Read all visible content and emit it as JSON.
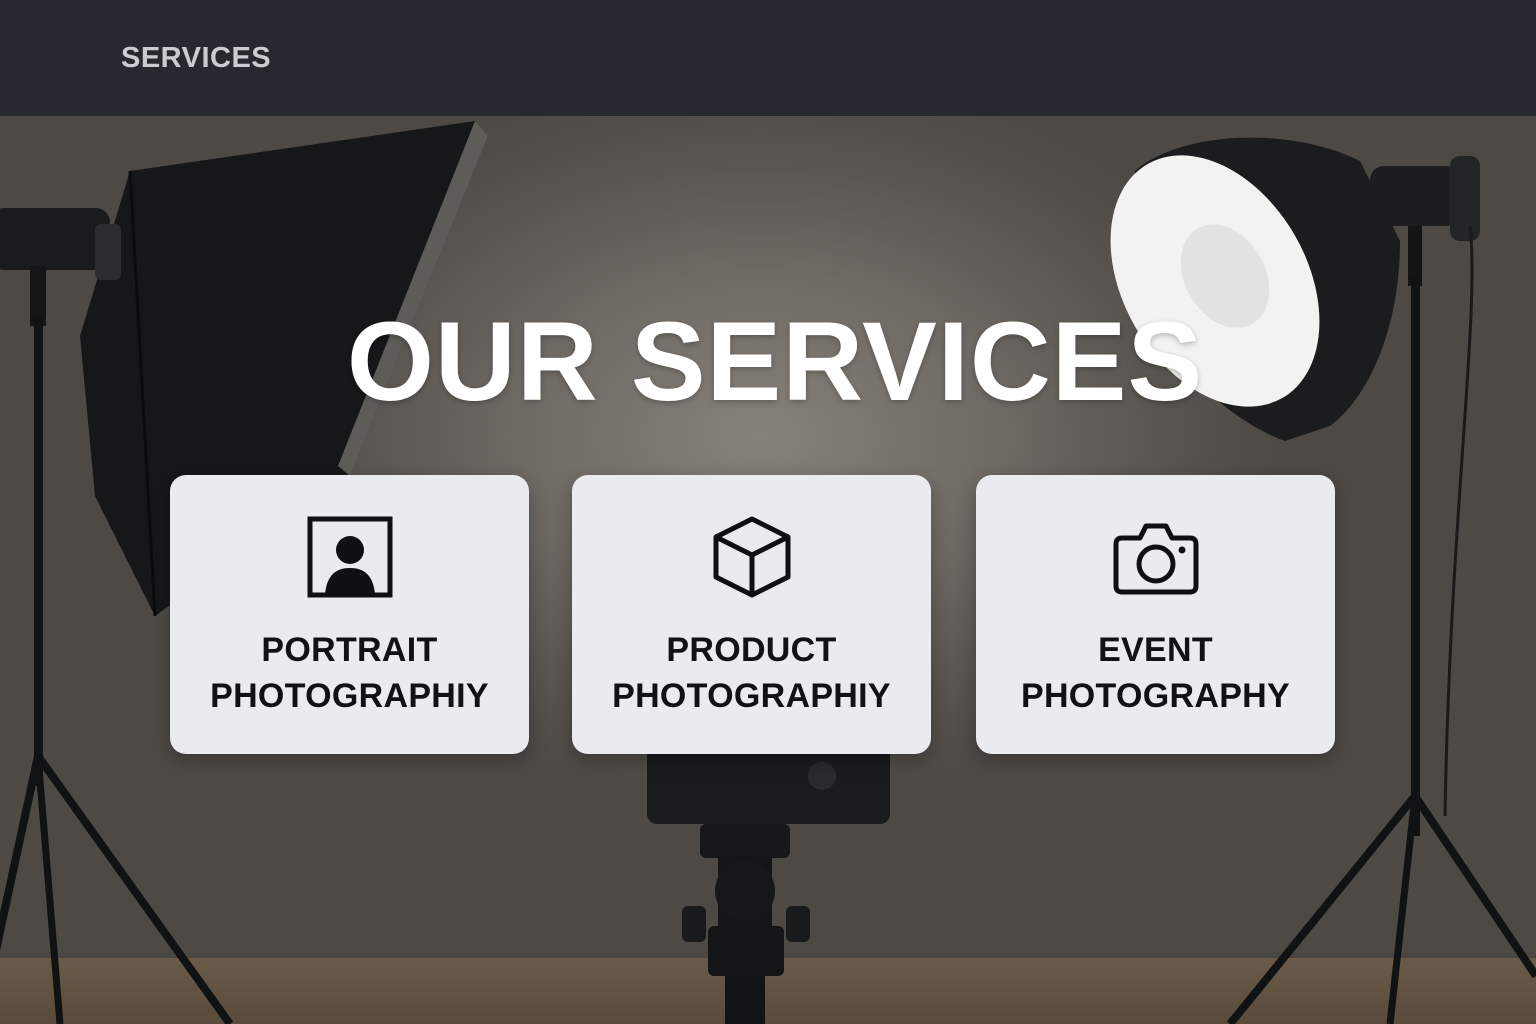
{
  "nav": {
    "services_link": "SERVICES"
  },
  "hero": {
    "title": "OUR SERVICES"
  },
  "services": [
    {
      "line1": "PORTRAIT",
      "line2": "PHOTOGRAPHIY",
      "icon": "portrait-icon"
    },
    {
      "line1": "PRODUCT",
      "line2": "PHOTOGRAPHIY",
      "icon": "box-icon"
    },
    {
      "line1": "EVENT",
      "line2": "PHOTOGRAPHY",
      "icon": "camera-icon"
    }
  ],
  "colors": {
    "topbar": "#262a30",
    "card": "#eaebef",
    "title": "#ffffff",
    "card_text": "#111214"
  }
}
